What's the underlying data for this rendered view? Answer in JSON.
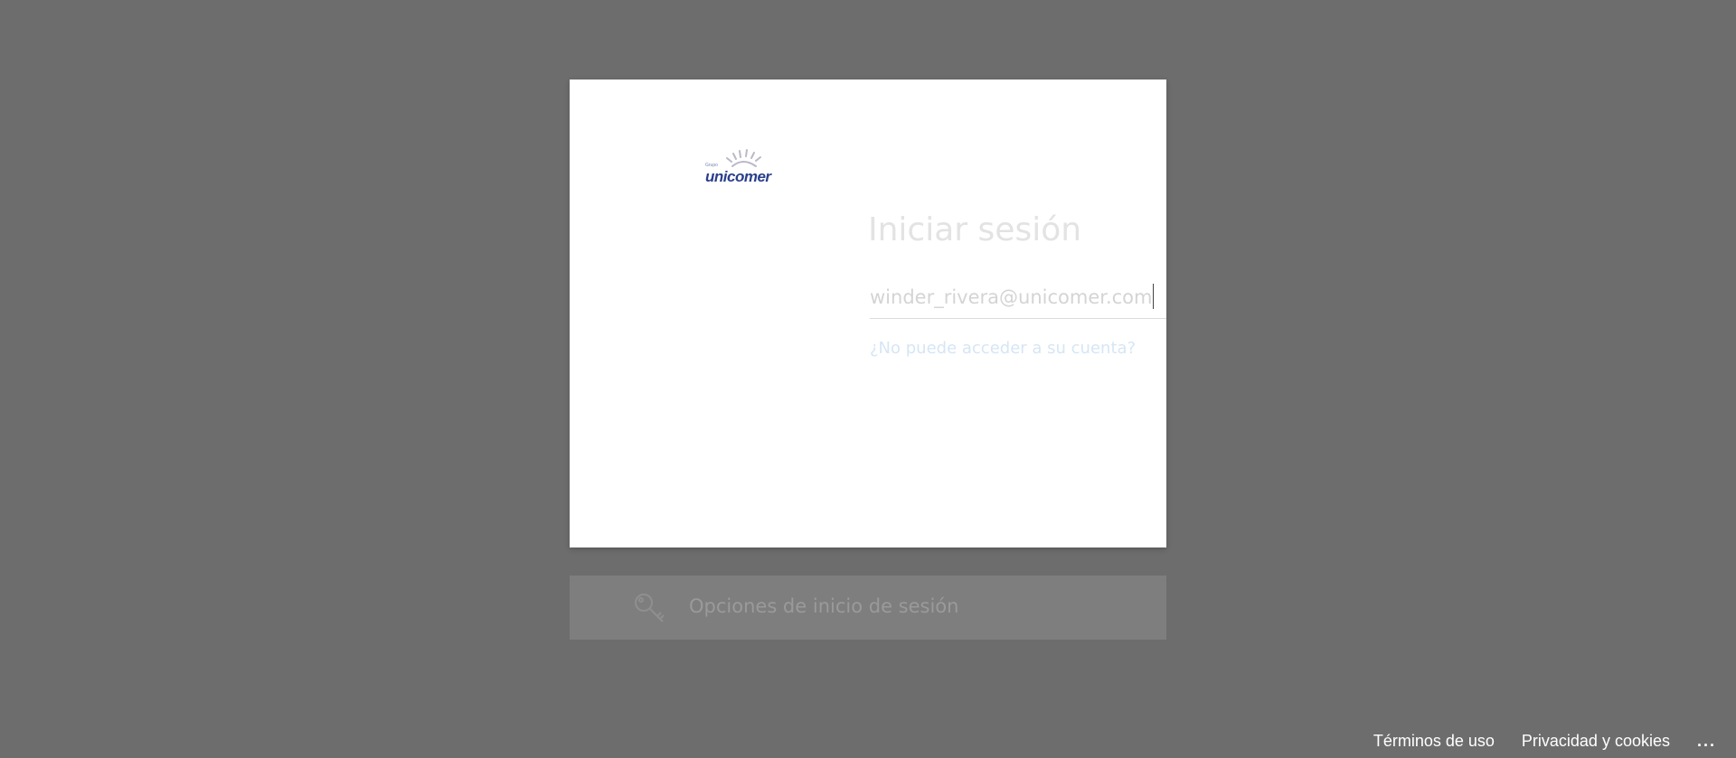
{
  "card": {
    "logo": {
      "brand_text": "unicomer",
      "small_text": "Grupo"
    },
    "title": "Iniciar sesión",
    "email": {
      "value": "winder_rivera@unicomer.com"
    },
    "help_link": "¿No puede acceder a su cuenta?"
  },
  "signin_options": {
    "icon": "key-icon",
    "label": "Opciones de inicio de sesión"
  },
  "footer": {
    "terms": "Términos de uso",
    "privacy": "Privacidad y cookies",
    "more": "..."
  },
  "colors": {
    "background": "#6d6d6d",
    "card": "#ffffff",
    "brand_blue": "#2b3f8c",
    "options_bar": "#7e7e7e"
  }
}
